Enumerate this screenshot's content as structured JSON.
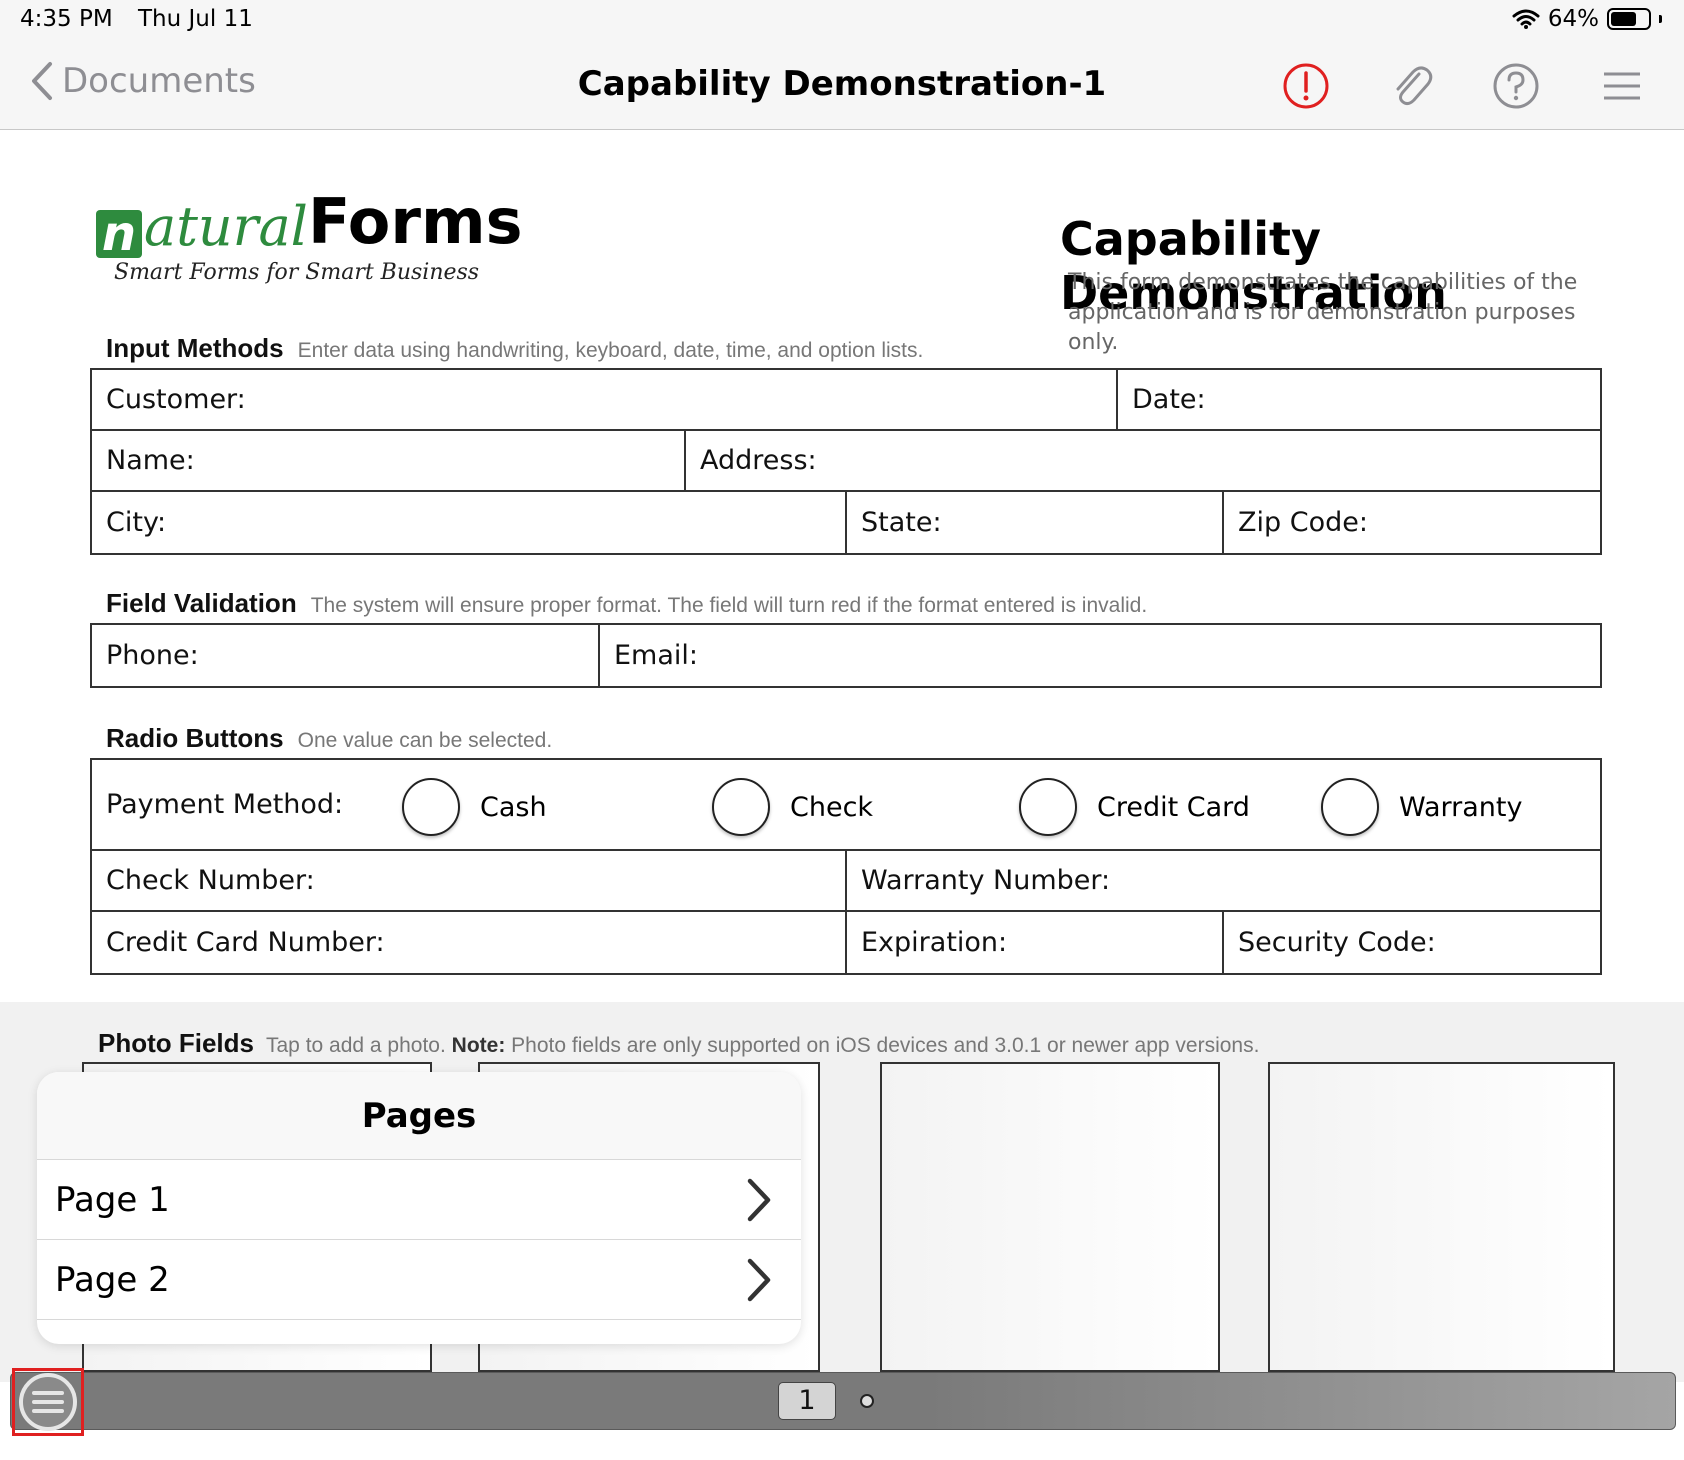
{
  "status_bar": {
    "time": "4:35 PM",
    "date": "Thu Jul 11",
    "battery": "64%"
  },
  "nav": {
    "back_label": "Documents",
    "title": "Capability Demonstration-1",
    "icons": [
      "alert-icon",
      "paperclip-icon",
      "help-icon",
      "menu-icon"
    ],
    "alert_color": "#e02020"
  },
  "form": {
    "logo": {
      "letter": "n",
      "script": "atural",
      "brand": "Forms",
      "tagline": "Smart Forms for Smart Business",
      "brand_color": "#2e8b3e"
    },
    "title": "Capability Demonstration",
    "description": "This form demonstrates the capabilities of the application and is for demonstration purposes only.",
    "input_methods": {
      "heading": "Input Methods",
      "hint": "Enter data using handwriting, keyboard, date, time, and option lists.",
      "customer": "Customer:",
      "date": "Date:",
      "name": "Name:",
      "address": "Address:",
      "city": "City:",
      "state": "State:",
      "zip": "Zip Code:"
    },
    "field_validation": {
      "heading": "Field Validation",
      "hint": "The system will ensure proper format. The field will turn red if the format entered is invalid.",
      "phone": "Phone:",
      "email": "Email:"
    },
    "radio_buttons": {
      "heading": "Radio Buttons",
      "hint": "One value can be selected.",
      "payment_label": "Payment Method:",
      "options": [
        "Cash",
        "Check",
        "Credit Card",
        "Warranty"
      ],
      "check_number": "Check Number:",
      "warranty_number": "Warranty Number:",
      "credit_card_number": "Credit Card Number:",
      "expiration": "Expiration:",
      "security_code": "Security Code:"
    },
    "photo_fields": {
      "heading": "Photo Fields",
      "hint_prefix": "Tap to add a photo.",
      "note_label": "Note:",
      "hint_suffix": "Photo fields are only supported on iOS devices and 3.0.1 or newer app versions."
    }
  },
  "pages_panel": {
    "title": "Pages",
    "items": [
      {
        "label": "Page 1"
      },
      {
        "label": "Page 2"
      }
    ]
  },
  "bottom_bar": {
    "current_page": "1"
  }
}
